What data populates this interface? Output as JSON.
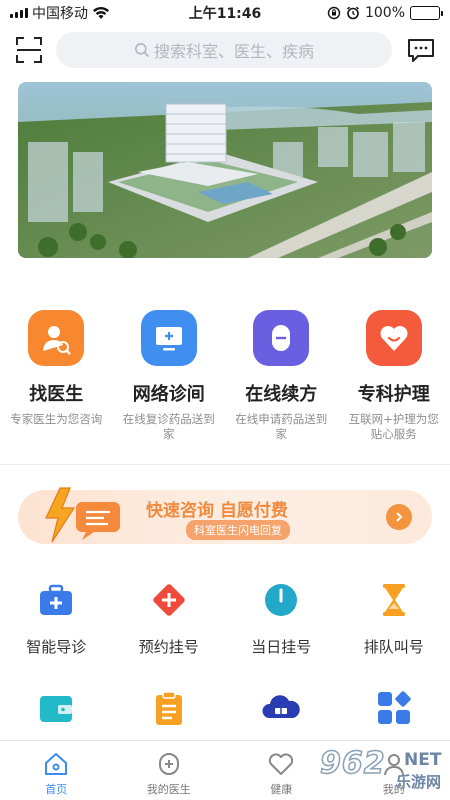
{
  "status": {
    "carrier": "中国移动",
    "time": "上午11:46",
    "battery": "100%"
  },
  "search": {
    "placeholder": "搜索科室、医生、疾病"
  },
  "services": [
    {
      "title": "找医生",
      "desc": "专家医生为您咨询",
      "color": "#f7882f"
    },
    {
      "title": "网络诊间",
      "desc": "在线复诊药品送到家",
      "color": "#3f8ef0"
    },
    {
      "title": "在线续方",
      "desc": "在线申请药品送到家",
      "color": "#6a5fe0"
    },
    {
      "title": "专科护理",
      "desc": "互联网+护理为您贴心服务",
      "color": "#f45b3d"
    }
  ],
  "promo": {
    "title": "快速咨询 自愿付费",
    "subtitle": "科室医生闪电回复"
  },
  "quick": [
    {
      "label": "智能导诊",
      "icon": "medical-kit-icon",
      "color": "#3a7be8"
    },
    {
      "label": "预约挂号",
      "icon": "red-cross-icon",
      "color": "#ef4a3b"
    },
    {
      "label": "当日挂号",
      "icon": "clock-icon",
      "color": "#22a9c9"
    },
    {
      "label": "排队叫号",
      "icon": "hourglass-icon",
      "color": "#f7a021"
    }
  ],
  "quick2": [
    {
      "icon": "wallet-icon",
      "color": "#22b9c8"
    },
    {
      "icon": "clipboard-icon",
      "color": "#f7a021"
    },
    {
      "icon": "cloud-icon",
      "color": "#2a3cb2"
    },
    {
      "icon": "apps-icon",
      "color": "#3a7be8"
    }
  ],
  "tabs": [
    {
      "label": "首页",
      "icon": "home-icon",
      "active": true
    },
    {
      "label": "我的医生",
      "icon": "doctor-icon",
      "active": false
    },
    {
      "label": "健康",
      "icon": "heart-icon",
      "active": false
    },
    {
      "label": "我的",
      "icon": "user-icon",
      "active": false
    }
  ],
  "watermark": {
    "number": "962",
    "net": "NET",
    "site": "乐游网"
  }
}
